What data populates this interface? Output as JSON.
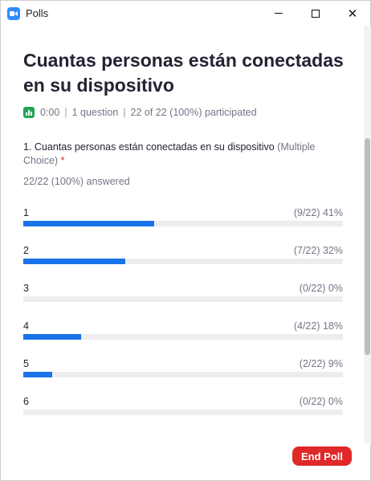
{
  "window": {
    "title": "Polls",
    "icon": "zoom-camera-icon",
    "controls": [
      "minimize-icon",
      "maximize-icon",
      "close-icon"
    ],
    "close_glyph": "✕"
  },
  "poll": {
    "title": "Cuantas personas están conectadas en su dispositivo",
    "meta": {
      "icon": "poll-results-icon",
      "time": "0:00",
      "separator": "|",
      "questions": "1 question",
      "participation": "22 of 22 (100%) participated"
    },
    "question": {
      "text": "1. Cuantas personas están conectadas en su dispositivo",
      "type_label": "(Multiple Choice)",
      "required_mark": "*"
    },
    "answered": "22/22 (100%) answered",
    "options": [
      {
        "label": "1",
        "result": "(9/22) 41%",
        "fraction": 0.41
      },
      {
        "label": "2",
        "result": "(7/22) 32%",
        "fraction": 0.32
      },
      {
        "label": "3",
        "result": "(0/22) 0%",
        "fraction": 0.0
      },
      {
        "label": "4",
        "result": "(4/22) 18%",
        "fraction": 0.18
      },
      {
        "label": "5",
        "result": "(2/22) 9%",
        "fraction": 0.09
      },
      {
        "label": "6",
        "result": "(0/22) 0%",
        "fraction": 0.0
      }
    ]
  },
  "footer": {
    "end_poll_label": "End Poll"
  },
  "colors": {
    "accent_blue": "#1a73e8",
    "end_button_red": "#e02828",
    "stats_icon_green": "#23a455",
    "muted_text": "#747487"
  }
}
